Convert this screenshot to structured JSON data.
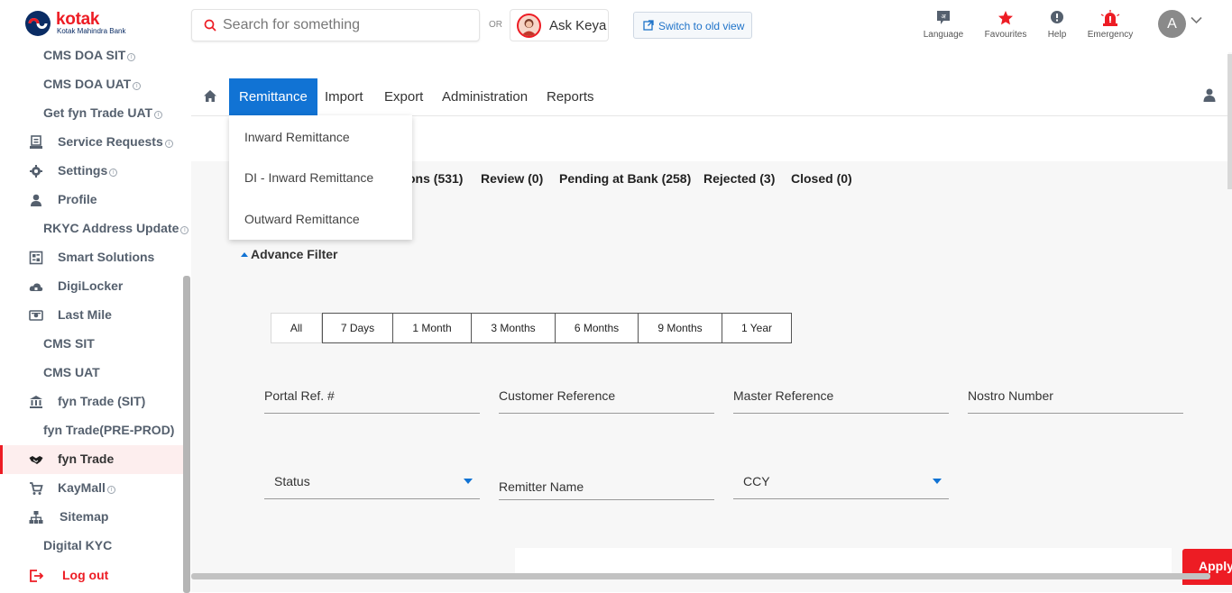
{
  "header": {
    "logo_brand": "kotak",
    "logo_sub": "Kotak Mahindra Bank",
    "search_placeholder": "Search for something",
    "or_label": "OR",
    "ask_keya": "Ask Keya",
    "switch_old_view": "Switch to old view",
    "items": [
      {
        "label": "Language",
        "icon": "language-icon"
      },
      {
        "label": "Favourites",
        "icon": "star-icon"
      },
      {
        "label": "Help",
        "icon": "help-icon"
      },
      {
        "label": "Emergency",
        "icon": "siren-icon"
      }
    ],
    "profile_initial": "A"
  },
  "sidebar": {
    "items": [
      {
        "label": "CMS DOA SIT",
        "info": true,
        "icon": null
      },
      {
        "label": "CMS DOA UAT",
        "info": true,
        "icon": null
      },
      {
        "label": "Get fyn Trade UAT",
        "info": true,
        "icon": null
      },
      {
        "label": "Service Requests",
        "info": true,
        "icon": "service-requests-icon"
      },
      {
        "label": "Settings",
        "info": true,
        "icon": "gear-icon"
      },
      {
        "label": "Profile",
        "info": false,
        "icon": "person-icon"
      },
      {
        "label": "RKYC Address Update",
        "info": true,
        "icon": null
      },
      {
        "label": "Smart Solutions",
        "info": false,
        "icon": "smart-solutions-icon"
      },
      {
        "label": "DigiLocker",
        "info": false,
        "icon": "cloud-lock-icon"
      },
      {
        "label": "Last Mile",
        "info": false,
        "icon": "cash-icon"
      },
      {
        "label": "CMS SIT",
        "info": false,
        "icon": null
      },
      {
        "label": "CMS UAT",
        "info": false,
        "icon": null
      },
      {
        "label": "fyn Trade (SIT)",
        "info": false,
        "icon": "bank-icon"
      },
      {
        "label": "fyn Trade(PRE-PROD)",
        "info": false,
        "icon": null
      },
      {
        "label": "fyn Trade",
        "info": false,
        "icon": "handshake-icon",
        "active": true
      },
      {
        "label": "KayMall",
        "info": true,
        "icon": "cart-icon"
      },
      {
        "label": "Sitemap",
        "info": false,
        "icon": "sitemap-icon"
      },
      {
        "label": "Digital KYC",
        "info": false,
        "icon": null
      },
      {
        "label": "Log out",
        "info": false,
        "icon": "logout-icon"
      }
    ]
  },
  "menu": {
    "tabs": [
      "Remittance",
      "Import",
      "Export",
      "Administration",
      "Reports"
    ],
    "active": "Remittance",
    "dropdown": [
      "Inward Remittance",
      "DI - Inward Remittance",
      "Outward Remittance"
    ]
  },
  "status_tabs": {
    "partial_first": "ons (531)",
    "review": "Review (0)",
    "pending": "Pending at Bank (258)",
    "rejected": "Rejected (3)",
    "closed": "Closed (0)"
  },
  "filter": {
    "title": "Advance Filter",
    "periods": [
      "All",
      "7 Days",
      "1 Month",
      "3 Months",
      "6 Months",
      "9 Months",
      "1 Year"
    ],
    "fields": {
      "portal_ref": "Portal Ref. #",
      "customer_ref": "Customer Reference",
      "master_ref": "Master Reference",
      "nostro": "Nostro Number",
      "status": "Status",
      "remitter": "Remitter Name",
      "ccy": "CCY"
    },
    "apply": "Apply"
  }
}
